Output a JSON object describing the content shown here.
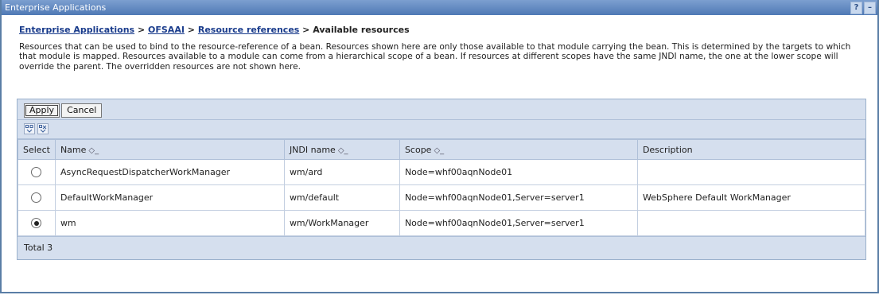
{
  "window": {
    "title": "Enterprise Applications",
    "help_label": "?",
    "minimize_label": "–"
  },
  "breadcrumb": {
    "items": [
      "Enterprise Applications",
      "OFSAAI",
      "Resource references"
    ],
    "separator": ">",
    "current": "Available resources"
  },
  "description": "Resources that can be used to bind to the resource-reference of a bean. Resources shown here are only those available to that module carrying the bean. This is determined by the targets to which that module is mapped. Resources available to a module can come from a hierarchical scope of a bean. If resources at different scopes have the same JNDI name, the one at the lower scope will override the parent. The overridden resources are not shown here.",
  "buttons": {
    "apply": "Apply",
    "cancel": "Cancel"
  },
  "table": {
    "headers": {
      "select": "Select",
      "name": "Name",
      "jndi": "JNDI name",
      "scope": "Scope",
      "description": "Description"
    },
    "rows": [
      {
        "selected": false,
        "name": "AsyncRequestDispatcherWorkManager",
        "jndi": "wm/ard",
        "scope": "Node=whf00aqnNode01",
        "description": ""
      },
      {
        "selected": false,
        "name": "DefaultWorkManager",
        "jndi": "wm/default",
        "scope": "Node=whf00aqnNode01,Server=server1",
        "description": "WebSphere Default WorkManager"
      },
      {
        "selected": true,
        "name": "wm",
        "jndi": "wm/WorkManager",
        "scope": "Node=whf00aqnNode01,Server=server1",
        "description": ""
      }
    ],
    "total": "Total 3"
  },
  "colors": {
    "title_bar": "#4f79b5",
    "panel": "#d5dfee",
    "link": "#1a3c8c"
  }
}
